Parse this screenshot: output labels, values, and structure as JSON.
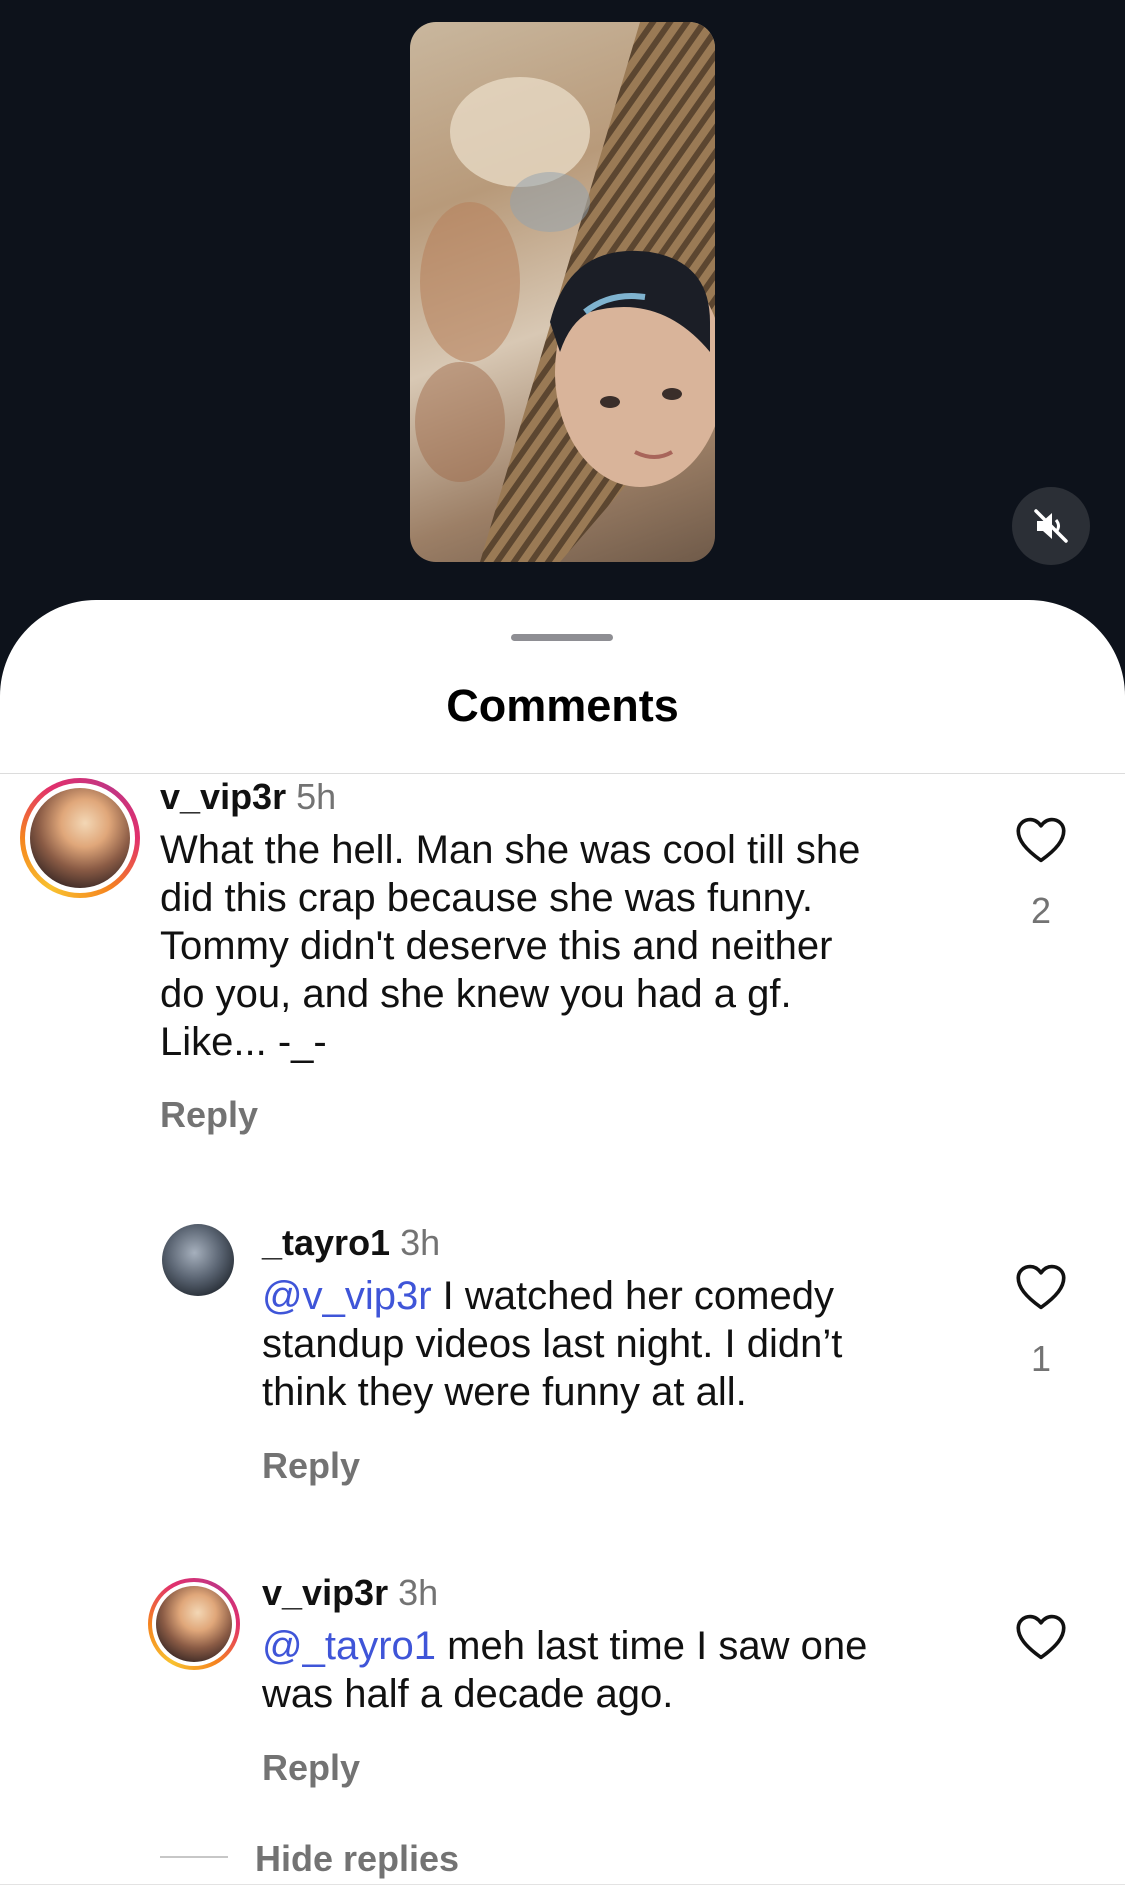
{
  "colors": {
    "mention": "#3f55d8",
    "meta_gray": "#737373",
    "background_dark": "#0d121b"
  },
  "video": {
    "mute_icon": "speaker-muted-icon"
  },
  "sheet": {
    "title": "Comments"
  },
  "comments": [
    {
      "username": "v_vip3r",
      "time": "5h",
      "text_lines": [
        "What the hell. Man she was cool till she",
        "did this crap because she was funny.",
        "Tommy didn't deserve this and neither",
        "do you, and she knew you had a gf.",
        "Like... -_-"
      ],
      "reply_label": "Reply",
      "likes": "2"
    },
    {
      "username": "_tayro1",
      "time": "3h",
      "mention": "@v_vip3r",
      "text_first": " I watched her comedy",
      "text_lines": [
        "standup videos last night. I didn’t",
        "think they were funny at all."
      ],
      "reply_label": "Reply",
      "likes": "1"
    },
    {
      "username": "v_vip3r",
      "time": "3h",
      "mention": "@_tayro1",
      "text_first": " meh last time I saw one",
      "text_lines": [
        "was half a decade ago."
      ],
      "reply_label": "Reply"
    }
  ],
  "hide_replies_label": "Hide replies"
}
